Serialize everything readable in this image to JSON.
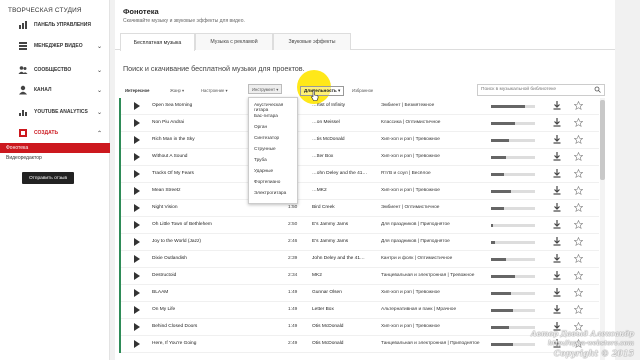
{
  "sidebar": {
    "studio_title": "ТВОРЧЕСКАЯ СТУДИЯ",
    "items": [
      {
        "label": "ПАНЕЛЬ УПРАВЛЕНИЯ",
        "icon": "dashboard-icon"
      },
      {
        "label": "МЕНЕДЖЕР ВИДЕО",
        "icon": "video-manager-icon"
      },
      {
        "label": "СООБЩЕСТВО",
        "icon": "community-icon"
      },
      {
        "label": "КАНАЛ",
        "icon": "channel-icon"
      },
      {
        "label": "YOUTUBE ANALYTICS",
        "icon": "analytics-icon"
      },
      {
        "label": "СОЗДАТЬ",
        "icon": "create-icon"
      }
    ],
    "sub_active": "Фонотека",
    "sub_item": "Видеоредактор",
    "feedback_button": "Отправить отзыв",
    "accent_color": "#cc181e"
  },
  "header": {
    "title": "Фонотека",
    "subtitle": "Скачивайте музыку и звуковые эффекты для видео."
  },
  "tabs": [
    "Бесплатная музыка",
    "Музыка с рекламой",
    "Звуковые эффекты"
  ],
  "search_heading": "Поиск и скачивание бесплатной музыки для проектов.",
  "toolbar": {
    "items": [
      "Интересное",
      "Жанр ▾",
      "Настроение ▾",
      "Инструмент ▾",
      "Длительность ▾",
      "Избранное"
    ],
    "search_placeholder": "Поиск в музыкальной библиотеке"
  },
  "instrument_dropdown": [
    "Акустическая гитара",
    "Бас-гитара",
    "Орган",
    "Синтезатор",
    "Струнные",
    "Труба",
    "Ударные",
    "Фортепиано",
    "Электрогитара"
  ],
  "tracks": [
    {
      "title": "Open Sea Morning",
      "duration": "",
      "artist": "…rtist of Infinity",
      "genre": "Эмбиент | Безмятежное",
      "popularity": 0.78
    },
    {
      "title": "Non Piu Andrai",
      "duration": "",
      "artist": "…on Meissel",
      "genre": "Классика | Оптимистичное",
      "popularity": 0.55
    },
    {
      "title": "Rich Man in the Sky",
      "duration": "",
      "artist": "…tis McDonald",
      "genre": "Хип-хоп и рэп | Тревожное",
      "popularity": 0.4
    },
    {
      "title": "Without A Sound",
      "duration": "",
      "artist": "…tter Box",
      "genre": "Хип-хоп и рэп | Тревожное",
      "popularity": 0.35
    },
    {
      "title": "Tracks Of My Fears",
      "duration": "",
      "artist": "…ohn Deley and the 41…",
      "genre": "R'n'B и соул | Весёлое",
      "popularity": 0.3
    },
    {
      "title": "Mean Streetz",
      "duration": "",
      "artist": "…MK2",
      "genre": "Хип-хоп и рэп | Тревожное",
      "popularity": 0.45
    },
    {
      "title": "Night Vision",
      "duration": "1:50",
      "artist": "Bird Creek",
      "genre": "Эмбиент | Оптимистичное",
      "popularity": 0.3
    },
    {
      "title": "Oh Little Town of Bethlehem",
      "duration": "2:50",
      "artist": "E's Jammy Jams",
      "genre": "Для праздников | Приподнятое",
      "popularity": 0.05
    },
    {
      "title": "Joy to the World (Jazz)",
      "duration": "2:46",
      "artist": "E's Jammy Jams",
      "genre": "Для праздников | Приподнятое",
      "popularity": 0.1
    },
    {
      "title": "Dixie Outlandish",
      "duration": "2:39",
      "artist": "John Deley and the 41…",
      "genre": "Кантри и фолк | Оптимистичное",
      "popularity": 0.35
    },
    {
      "title": "Destructoid",
      "duration": "2:34",
      "artist": "MK2",
      "genre": "Танцевальная и электронная | Тревожное",
      "popularity": 0.55
    },
    {
      "title": "BLAAM",
      "duration": "1:49",
      "artist": "Gunnar Olsen",
      "genre": "Хип-хоп и рэп | Тревожное",
      "popularity": 0.45
    },
    {
      "title": "On My Life",
      "duration": "1:49",
      "artist": "Letter Box",
      "genre": "Альтернативная и панк | Мрачное",
      "popularity": 0.5
    },
    {
      "title": "Behind Closed Doors",
      "duration": "1:49",
      "artist": "Otis McDonald",
      "genre": "Хип-хоп и рэп | Тревожное",
      "popularity": 0.4
    },
    {
      "title": "Here, If You're Going",
      "duration": "2:49",
      "artist": "Otis McDonald",
      "genre": "Танцевальная и электронная | Приподнятое",
      "popularity": 0.5
    }
  ],
  "duration_filter_label": "Длительность ▾",
  "watermark": [
    "Автор Давыд Александр",
    "http://open-webstore.com",
    "Copyright © 2015"
  ],
  "colors": {
    "stripe": "#2e8b57",
    "highlight": "#ffe600"
  }
}
